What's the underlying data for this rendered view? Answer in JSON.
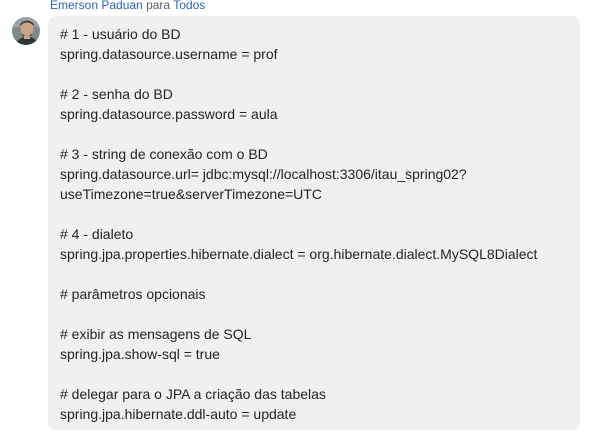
{
  "header": {
    "sender": "Emerson Paduan",
    "to_word": "para",
    "recipient": "Todos"
  },
  "avatar": {
    "icon": "user-avatar-photo"
  },
  "message": {
    "lines": [
      "# 1 - usuário do BD",
      "spring.datasource.username = prof",
      "",
      "# 2 - senha do BD",
      "spring.datasource.password = aula",
      "",
      "# 3 - string de conexão com o BD",
      "spring.datasource.url= jdbc:mysql://localhost:3306/itau_spring02?",
      "useTimezone=true&serverTimezone=UTC",
      "",
      "# 4 - dialeto",
      "spring.jpa.properties.hibernate.dialect = org.hibernate.dialect.MySQL8Dialect",
      "",
      "# parâmetros opcionais",
      "",
      "# exibir as mensagens de SQL",
      "spring.jpa.show-sql = true",
      "",
      "# delegar para o JPA a criação das tabelas",
      "spring.jpa.hibernate.ddl-auto = update"
    ]
  },
  "colors": {
    "sender": "#2a62b8",
    "bubble_background": "#f0f0f0",
    "text": "#242424"
  }
}
